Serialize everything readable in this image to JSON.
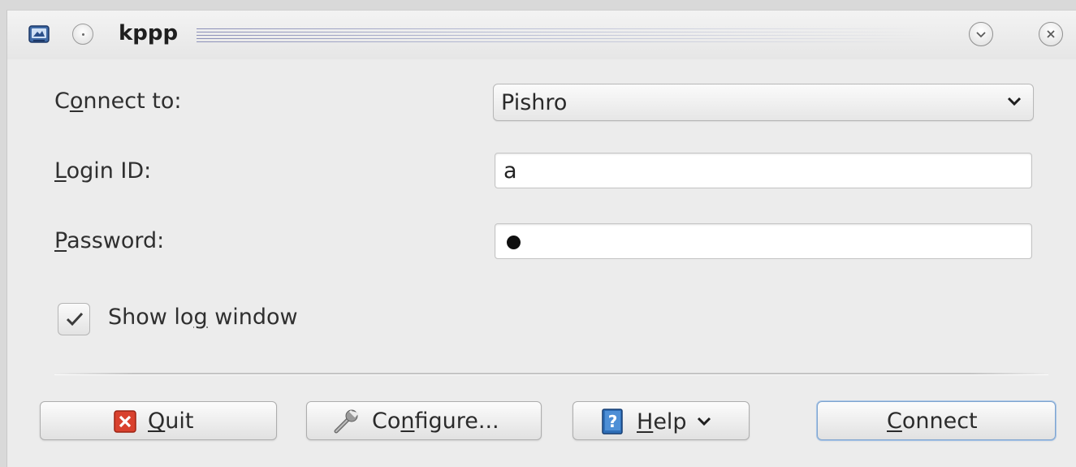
{
  "window": {
    "title": "kppp"
  },
  "form": {
    "connect_to_label": {
      "pre": "C",
      "accel": "o",
      "post": "nnect to:"
    },
    "connect_to_value": "Pishro",
    "login_label": {
      "pre": "",
      "accel": "L",
      "post": "ogin ID:"
    },
    "login_value": "a",
    "password_label": {
      "pre": "",
      "accel": "P",
      "post": "assword:"
    },
    "password_masked_length": 1,
    "show_log": {
      "checked": true,
      "pre": "Show lo",
      "accel": "g",
      "post": " window"
    }
  },
  "buttons": {
    "quit": {
      "pre": "",
      "accel": "Q",
      "post": "uit"
    },
    "configure": {
      "pre": "Co",
      "accel": "n",
      "post": "figure..."
    },
    "help": {
      "pre": "",
      "accel": "H",
      "post": "elp"
    },
    "connect": {
      "pre": "",
      "accel": "C",
      "post": "onnect"
    }
  },
  "icons": {
    "app": "kppp-app-icon",
    "window_menu": "window-menu-icon",
    "minimize": "chevron-down-icon",
    "close": "close-icon",
    "combo_arrow": "chevron-down-icon",
    "check": "check-icon",
    "quit": "quit-x-icon",
    "configure": "wrench-icon",
    "help": "help-book-icon",
    "help_arrow": "chevron-down-icon"
  },
  "colors": {
    "window_bg": "#ececec",
    "focus_accent": "#7ea4cf",
    "quit_icon_red": "#d9412e"
  }
}
